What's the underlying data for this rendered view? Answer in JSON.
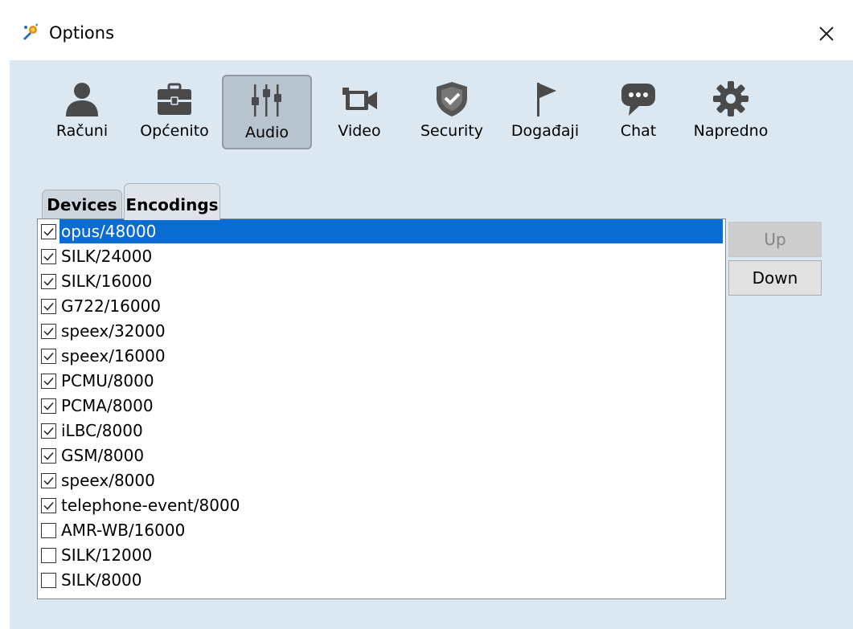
{
  "window": {
    "title": "Options",
    "icon": "sip-communicator-icon",
    "close_icon": "close-icon"
  },
  "toolbar": {
    "items": [
      {
        "label": "Računi",
        "icon": "user-icon"
      },
      {
        "label": "Općenito",
        "icon": "briefcase-icon"
      },
      {
        "label": "Audio",
        "icon": "sliders-icon",
        "active": true
      },
      {
        "label": "Video",
        "icon": "video-camera-icon"
      },
      {
        "label": "Security",
        "icon": "shield-icon"
      },
      {
        "label": "Događaji",
        "icon": "flag-icon"
      },
      {
        "label": "Chat",
        "icon": "chat-bubble-icon"
      },
      {
        "label": "Napredno",
        "icon": "gear-icon"
      }
    ]
  },
  "tabs": [
    {
      "label": "Devices"
    },
    {
      "label": "Encodings",
      "active": true
    }
  ],
  "encodings": {
    "items": [
      {
        "label": "opus/48000",
        "checked": true,
        "selected": true
      },
      {
        "label": "SILK/24000",
        "checked": true
      },
      {
        "label": "SILK/16000",
        "checked": true
      },
      {
        "label": "G722/16000",
        "checked": true
      },
      {
        "label": "speex/32000",
        "checked": true
      },
      {
        "label": "speex/16000",
        "checked": true
      },
      {
        "label": "PCMU/8000",
        "checked": true
      },
      {
        "label": "PCMA/8000",
        "checked": true
      },
      {
        "label": "iLBC/8000",
        "checked": true
      },
      {
        "label": "GSM/8000",
        "checked": true
      },
      {
        "label": "speex/8000",
        "checked": true
      },
      {
        "label": "telephone-event/8000",
        "checked": true
      },
      {
        "label": "AMR-WB/16000",
        "checked": false
      },
      {
        "label": "SILK/12000",
        "checked": false
      },
      {
        "label": "SILK/8000",
        "checked": false
      }
    ],
    "up_label": "Up",
    "up_enabled": false,
    "down_label": "Down"
  },
  "colors": {
    "panel_bg": "#dbe7f1",
    "selection": "#0a6cd2",
    "active_tool_bg": "#b7c4d0"
  }
}
